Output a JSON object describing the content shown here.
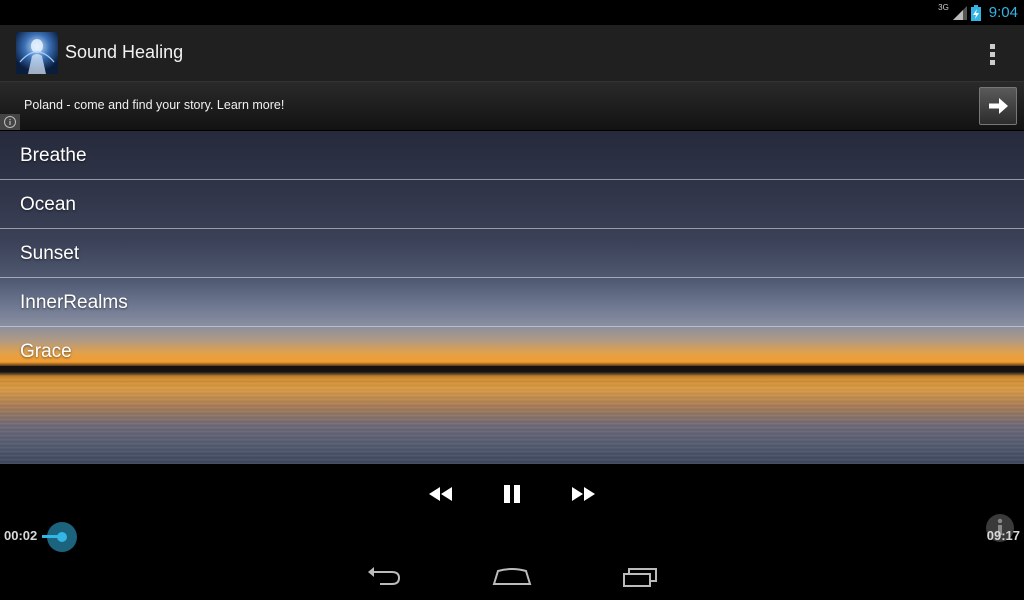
{
  "status_bar": {
    "network": "3G",
    "time": "9:04",
    "icons": [
      "signal-icon",
      "battery-charging-icon"
    ]
  },
  "action_bar": {
    "title": "Sound Healing",
    "app_icon": "app-logo-icon",
    "overflow_icon": "overflow-menu-icon"
  },
  "ad": {
    "text": "Poland - come and find your story. Learn more!",
    "info_icon": "info-icon",
    "arrow_icon": "arrow-right-icon"
  },
  "tracks": [
    {
      "label": "Breathe"
    },
    {
      "label": "Ocean"
    },
    {
      "label": "Sunset"
    },
    {
      "label": "InnerRealms"
    },
    {
      "label": "Grace"
    }
  ],
  "player": {
    "elapsed": "00:02",
    "duration": "09:17",
    "controls": [
      "rewind-icon",
      "pause-icon",
      "fast-forward-icon"
    ],
    "progress_fraction": 0.004
  },
  "nav_bar": {
    "icons": [
      "back-icon",
      "home-icon",
      "recent-apps-icon"
    ]
  },
  "colors": {
    "accent": "#33b5e5",
    "action_bar": "#202020",
    "background": "#000000"
  }
}
